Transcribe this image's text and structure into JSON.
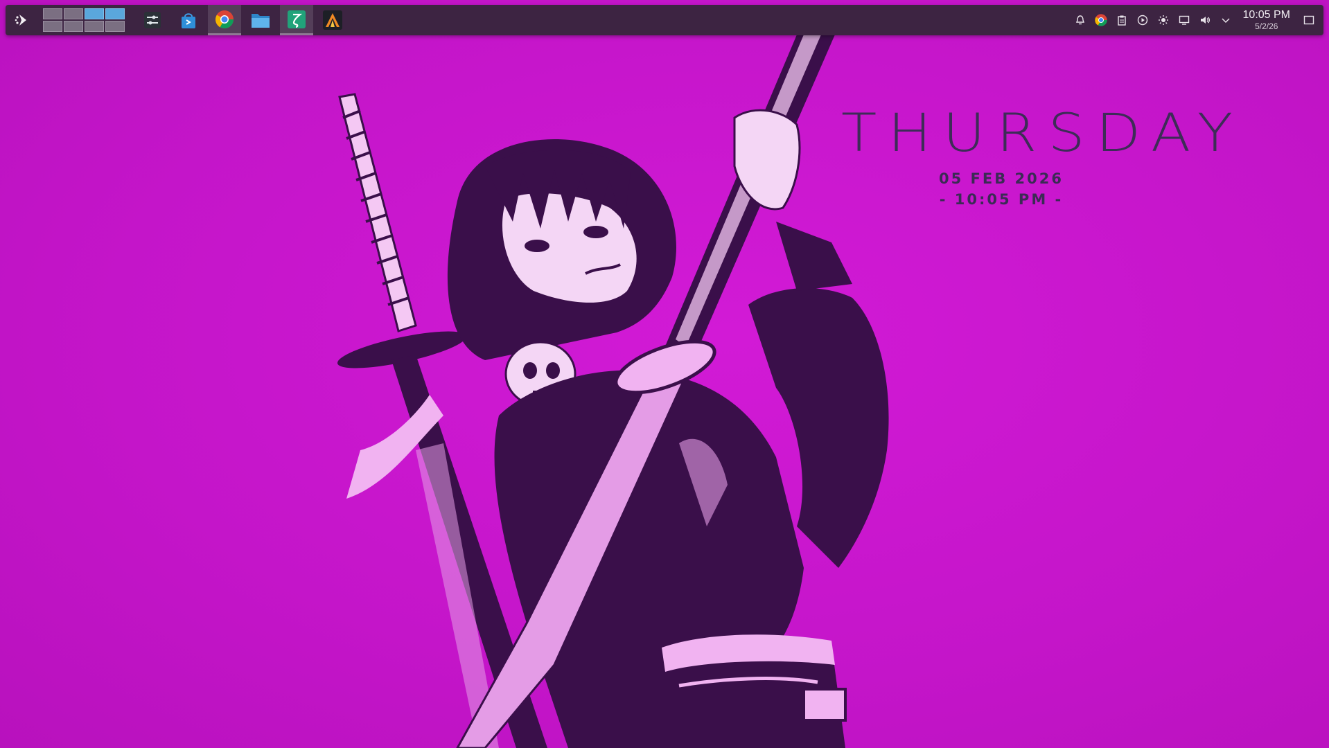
{
  "panel": {
    "launcher_icon": "kde-launcher-icon",
    "pager": {
      "desktops": 8,
      "active_index": 3
    },
    "tasks": [
      {
        "name": "system-settings",
        "icon": "settings-sliders-icon",
        "active": false
      },
      {
        "name": "discover-store",
        "icon": "store-bag-icon",
        "active": false
      },
      {
        "name": "chrome",
        "icon": "chrome-icon",
        "active": true
      },
      {
        "name": "file-manager",
        "icon": "folder-icon",
        "active": false
      },
      {
        "name": "zed-editor",
        "icon": "zeta-app-icon",
        "active": true
      },
      {
        "name": "alacritty",
        "icon": "terminal-a-icon",
        "active": false
      }
    ],
    "tray": {
      "icons": [
        "notifications-icon",
        "chrome-tray-icon",
        "clipboard-icon",
        "media-play-icon",
        "brightness-icon",
        "display-icon",
        "volume-icon",
        "expand-tray-icon"
      ],
      "clock_time": "10:05 PM",
      "clock_date": "5/2/26"
    }
  },
  "widget": {
    "day": "THURSDAY",
    "date": "05 FEB 2026",
    "time": "- 10:05 PM -"
  },
  "colors": {
    "wallpaper": "#cc18d1",
    "panel": "#3d2442",
    "widget_text": "#3b2b55",
    "figure_dark": "#3a0f4a",
    "figure_light": "#f1b3f1"
  }
}
